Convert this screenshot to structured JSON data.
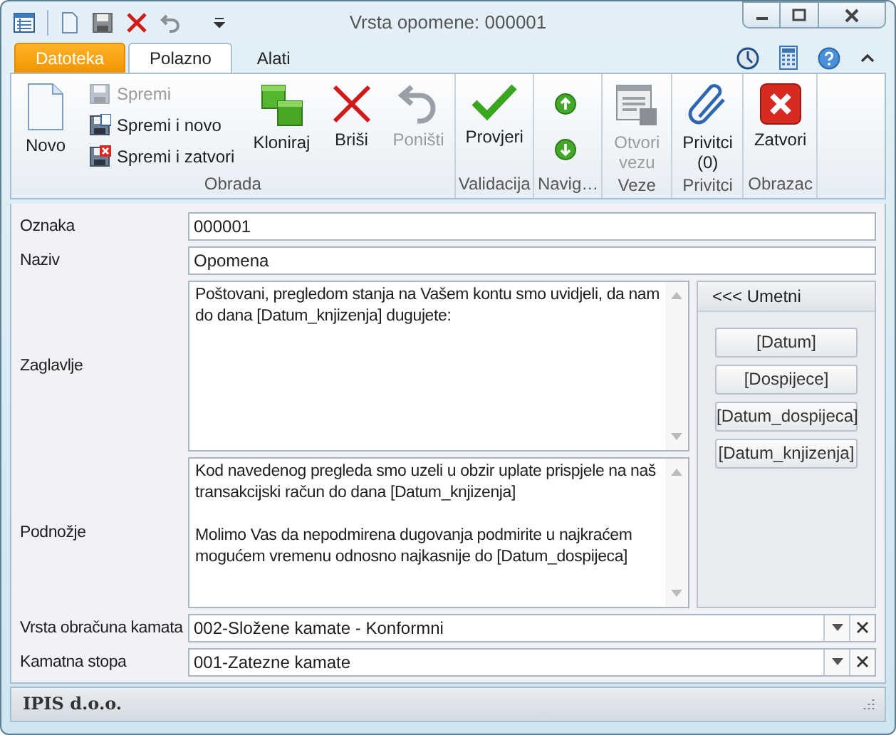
{
  "window": {
    "title": "Vrsta opomene: 000001"
  },
  "tabs": [
    {
      "label": "Datoteka",
      "kind": "file",
      "selected": false
    },
    {
      "label": "Polazno",
      "kind": "tab",
      "selected": true
    },
    {
      "label": "Alati",
      "kind": "tab",
      "selected": false
    }
  ],
  "ribbon": {
    "groups": [
      {
        "label": "Obrada",
        "items": [
          {
            "kind": "large",
            "label": "Novo",
            "disabled": false
          },
          {
            "kind": "stack",
            "buttons": [
              {
                "label": "Spremi",
                "disabled": true
              },
              {
                "label": "Spremi i novo",
                "disabled": false
              },
              {
                "label": "Spremi i zatvori",
                "disabled": false
              }
            ]
          },
          {
            "kind": "large",
            "label": "Kloniraj",
            "disabled": false
          },
          {
            "kind": "large",
            "label": "Briši",
            "disabled": false
          },
          {
            "kind": "large",
            "label": "Poništi",
            "disabled": true
          }
        ]
      },
      {
        "label": "Validacija",
        "items": [
          {
            "kind": "large",
            "label": "Provjeri",
            "disabled": false
          }
        ]
      },
      {
        "label": "Navig…",
        "items": [
          {
            "kind": "nav"
          }
        ]
      },
      {
        "label": "Veze",
        "items": [
          {
            "kind": "large",
            "label": "Otvori\nvezu",
            "disabled": true
          }
        ]
      },
      {
        "label": "Privitci",
        "items": [
          {
            "kind": "large",
            "label": "Privitci\n(0)",
            "disabled": false
          }
        ]
      },
      {
        "label": "Obrazac",
        "items": [
          {
            "kind": "large",
            "label": "Zatvori",
            "disabled": false
          }
        ]
      }
    ]
  },
  "form": {
    "fields": [
      {
        "kind": "text",
        "label": "Oznaka",
        "value": "000001"
      },
      {
        "kind": "text",
        "label": "Naziv",
        "value": "Opomena"
      },
      {
        "kind": "memo",
        "label": "Zaglavlje",
        "value": "Poštovani, pregledom stanja na Vašem kontu smo uvidjeli, da nam do dana [Datum_knjizenja] dugujete:"
      },
      {
        "kind": "memo",
        "label": "Podnožje",
        "value": "Kod navedenog pregleda smo uzeli u obzir uplate prispjele na naš transakcijski račun do dana [Datum_knjizenja]\n\nMolimo Vas da nepodmirena dugovanja podmirite u najkraćem mogućem vremenu odnosno najkasnije do [Datum_dospijeca]"
      },
      {
        "kind": "combo",
        "label": "Vrsta obračuna kamata",
        "value": "002-Složene kamate - Konformni"
      },
      {
        "kind": "combo",
        "label": "Kamatna stopa",
        "value": "001-Zatezne kamate"
      }
    ],
    "insert_panel": {
      "title": "<<< Umetni",
      "buttons": [
        "[Datum]",
        "[Dospijece]",
        "[Datum_dospijeca]",
        "[Datum_knjizenja]"
      ]
    }
  },
  "status_bar": {
    "text": "IPIS d.o.o."
  }
}
